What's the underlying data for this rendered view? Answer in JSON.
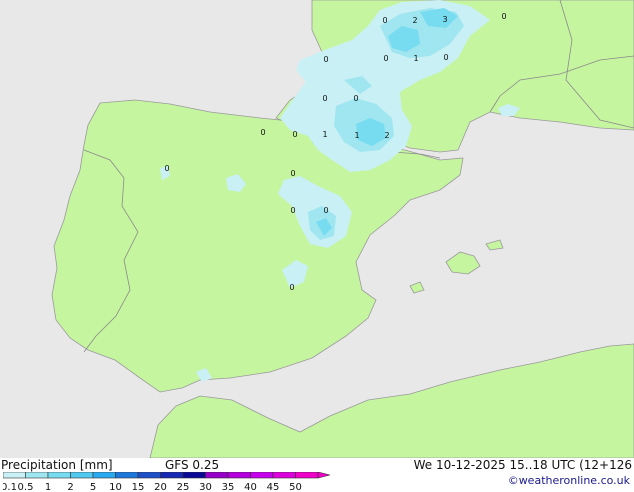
{
  "footer": {
    "title": "Precipitation [mm]",
    "model": "GFS 0.25",
    "datetime": "We 10-12-2025 15..18 UTC (12+126",
    "credit": "©weatheronline.co.uk"
  },
  "legend": {
    "labels": [
      "0.1",
      "0.5",
      "1",
      "2",
      "5",
      "10",
      "15",
      "20",
      "25",
      "30",
      "35",
      "40",
      "45",
      "50"
    ],
    "colors": [
      "#c8f0f5",
      "#a0e6f0",
      "#78dcf0",
      "#50c8f0",
      "#28aaf0",
      "#1e78dc",
      "#1e50c8",
      "#1428b4",
      "#0a0a96",
      "#9600c8",
      "#b400dc",
      "#c800f0",
      "#dc00dc",
      "#f000c8"
    ]
  },
  "map_values": [
    "0",
    "2",
    "3",
    "0",
    "0",
    "0",
    "1",
    "0",
    "0",
    "0",
    "0",
    "1",
    "1",
    "2",
    "0",
    "0",
    "0",
    "0",
    "0",
    "0"
  ]
}
